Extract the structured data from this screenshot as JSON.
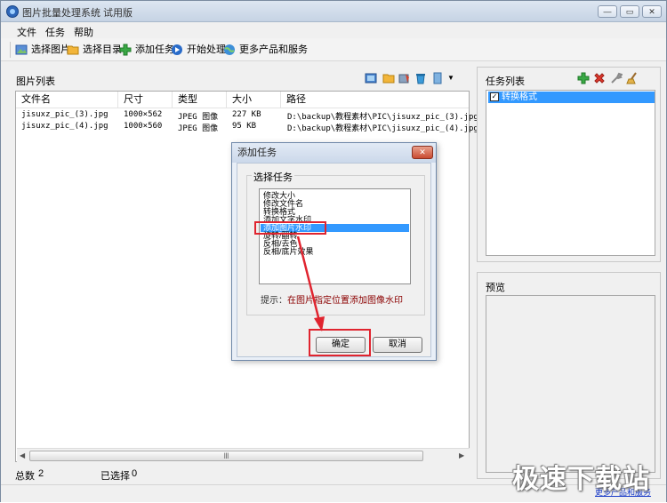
{
  "window": {
    "title": "图片批量处理系统 试用版",
    "controls": [
      "—",
      "▭",
      "✕"
    ]
  },
  "menu": [
    "文件",
    "任务",
    "帮助"
  ],
  "toolbar": {
    "select_image": "选择图片",
    "select_folder": "选择目录",
    "add_task": "添加任务",
    "start_process": "开始处理",
    "more_products": "更多产品和服务"
  },
  "image_list": {
    "title": "图片列表",
    "columns": [
      "文件名",
      "尺寸",
      "类型",
      "大小",
      "路径"
    ],
    "rows": [
      [
        "jisuxz_pic_(3).jpg",
        "1000×562",
        "JPEG 图像",
        "227 KB",
        "D:\\backup\\教程素材\\PIC\\jisuxz_pic_(3).jpg"
      ],
      [
        "jisuxz_pic_(4).jpg",
        "1000×560",
        "JPEG 图像",
        "95 KB",
        "D:\\backup\\教程素材\\PIC\\jisuxz_pic_(4).jpg"
      ]
    ],
    "scroll_grip": "Ⅲ"
  },
  "status": {
    "total_label": "总数",
    "total_value": "2",
    "selected_label": "已选择",
    "selected_value": "0"
  },
  "task_panel": {
    "title": "任务列表",
    "items": [
      {
        "label": "转换格式",
        "checked": true
      }
    ]
  },
  "preview_panel": {
    "title": "预览"
  },
  "dialog": {
    "title": "添加任务",
    "close": "✕",
    "group_label": "选择任务",
    "options": [
      "修改大小",
      "修改文件名",
      "转换格式",
      "添加文字水印",
      "添加图片水印",
      "旋转/翻转",
      "反相/去色",
      "反相/底片效果"
    ],
    "selected_index": 4,
    "hint_label": "提示：",
    "hint_text": "在图片指定位置添加图像水印",
    "ok": "确定",
    "cancel": "取消"
  },
  "watermark": "极速下载站",
  "footer_link": "更多产品和服务",
  "colors": {
    "selection": "#3399ff",
    "highlight_box": "#e0242f",
    "hint": "#8b0000"
  }
}
